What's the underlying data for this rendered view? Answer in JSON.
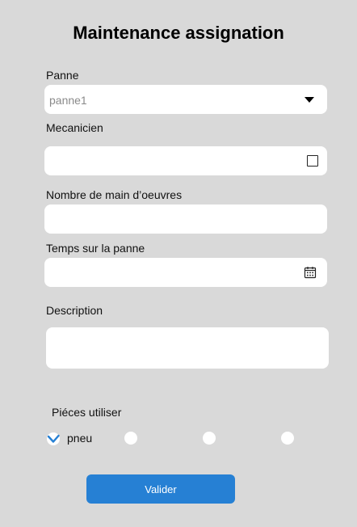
{
  "form": {
    "title": "Maintenance assignation",
    "panne": {
      "label": "Panne",
      "value": "panne1"
    },
    "mecanicien": {
      "label": "Mecanicien",
      "value": ""
    },
    "main_oeuvres": {
      "label": "Nombre de main d’oeuvres",
      "value": ""
    },
    "temps": {
      "label": "Temps sur la panne",
      "value": ""
    },
    "description": {
      "label": "Description",
      "value": ""
    },
    "pieces": {
      "label": "Piéces utiliser",
      "options": [
        {
          "label": "pneu",
          "checked": true
        },
        {
          "label": "",
          "checked": false
        },
        {
          "label": "",
          "checked": false
        },
        {
          "label": "",
          "checked": false
        }
      ]
    },
    "submit_label": "Valider"
  },
  "colors": {
    "background": "#d9d9d9",
    "accent": "#2680d4",
    "field": "#ffffff"
  },
  "icons": {
    "panne_select": "chevron-down-icon",
    "mecanicien_field": "square-icon",
    "temps_field": "calendar-icon",
    "pieces_selected": "check-icon"
  }
}
